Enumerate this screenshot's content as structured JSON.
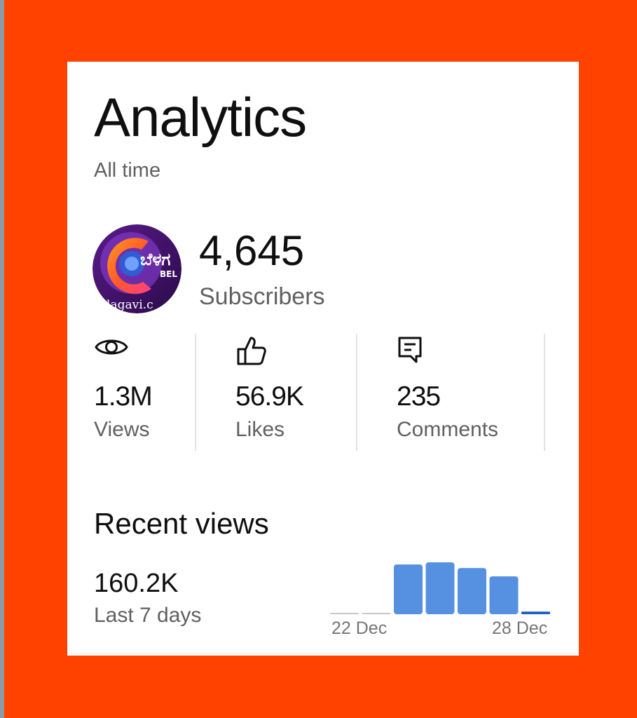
{
  "header": {
    "title": "Analytics",
    "subtitle": "All time"
  },
  "channel": {
    "avatar_icon": "channel-logo",
    "avatar_text_top": "ಬೆಳಗ",
    "avatar_text_side": "BEL",
    "avatar_text_bottom": "elagavi.c",
    "subscribers_value": "4,645",
    "subscribers_label": "Subscribers"
  },
  "stats": [
    {
      "icon": "eye-icon",
      "value": "1.3M",
      "label": "Views"
    },
    {
      "icon": "thumbs-up-icon",
      "value": "56.9K",
      "label": "Likes"
    },
    {
      "icon": "comment-icon",
      "value": "235",
      "label": "Comments"
    }
  ],
  "recent": {
    "title": "Recent views",
    "value": "160.2K",
    "period": "Last 7 days"
  },
  "chart_data": {
    "type": "bar",
    "x_start_label": "22 Dec",
    "x_end_label": "28 Dec",
    "values": [
      0.01,
      0.02,
      0.96,
      1.0,
      0.89,
      0.73,
      0.05
    ],
    "unit": "relative to tallest bar",
    "colors": {
      "bar": "#5591e0",
      "baseline": "#c8c8c8",
      "last_bar": "#1a5ec9"
    }
  },
  "colors": {
    "background": "#ff4200",
    "card": "#ffffff",
    "primary_text": "#0f0f0f",
    "secondary_text": "#606060"
  }
}
